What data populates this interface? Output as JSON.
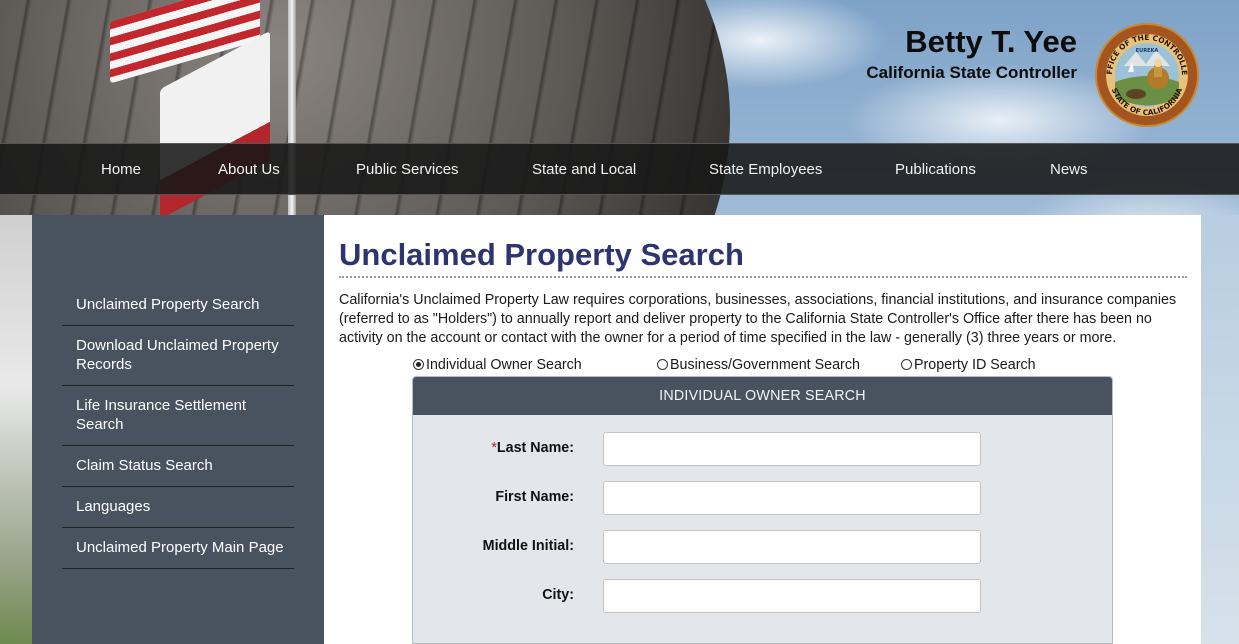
{
  "header": {
    "name": "Betty T. Yee",
    "subtitle": "California State Controller",
    "seal_text_top": "OFFICE OF THE CONTROLLER",
    "seal_text_bottom": "STATE OF CALIFORNIA",
    "seal_motto": "EUREKA"
  },
  "nav": {
    "items": [
      {
        "label": "Home"
      },
      {
        "label": "About Us"
      },
      {
        "label": "Public Services"
      },
      {
        "label": "State and Local"
      },
      {
        "label": "State Employees"
      },
      {
        "label": "Publications"
      },
      {
        "label": "News"
      }
    ]
  },
  "sidebar": {
    "items": [
      {
        "label": "Unclaimed Property Search"
      },
      {
        "label": "Download Unclaimed Property Records"
      },
      {
        "label": "Life Insurance Settlement Search"
      },
      {
        "label": "Claim Status Search"
      },
      {
        "label": "Languages"
      },
      {
        "label": "Unclaimed Property Main Page"
      }
    ]
  },
  "main": {
    "title": "Unclaimed Property Search",
    "intro": "California's Unclaimed Property Law requires corporations, businesses, associations, financial institutions, and insurance companies (referred to as \"Holders\") to annually report and deliver property to the California State Controller's Office after there has been no activity on the account or contact with the owner for a period of time specified in the law - generally (3) three years or more.",
    "search_types": [
      {
        "label": "Individual Owner Search",
        "selected": true
      },
      {
        "label": "Business/Government Search",
        "selected": false
      },
      {
        "label": "Property ID Search",
        "selected": false
      }
    ],
    "panel": {
      "header": "INDIVIDUAL OWNER SEARCH",
      "required_marker": "*",
      "fields": [
        {
          "label": "Last Name:",
          "value": "",
          "required": true
        },
        {
          "label": "First Name:",
          "value": "",
          "required": false
        },
        {
          "label": "Middle Initial:",
          "value": "",
          "required": false
        },
        {
          "label": "City:",
          "value": "",
          "required": false
        }
      ]
    }
  },
  "colors": {
    "nav_bg": "#181818",
    "sidebar_bg": "#48535f",
    "title_color": "#2e3470",
    "panel_bg": "#e3e7ec",
    "required_color": "#c0182d"
  }
}
